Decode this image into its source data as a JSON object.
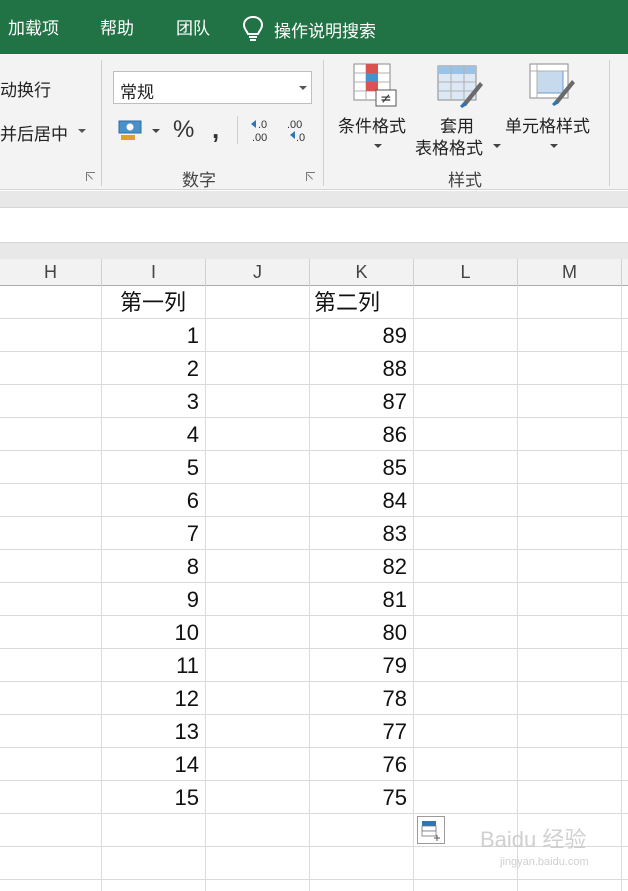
{
  "menu": {
    "items": [
      "加载项",
      "帮助",
      "团队"
    ],
    "search_placeholder": "操作说明搜索"
  },
  "ribbon": {
    "alignment": {
      "wrap_text": "动换行",
      "merge_center": "并后居中"
    },
    "number": {
      "format_value": "常规",
      "percent_symbol": "%",
      "comma_symbol": ",",
      "increase_decimal": "←.0\n.00",
      "decrease_decimal": ".00\n→.0",
      "group_label": "数字"
    },
    "styles": {
      "conditional_formatting": "条件格式",
      "format_as_table_line1": "套用",
      "format_as_table_line2": "表格格式",
      "cell_styles": "单元格样式",
      "group_label": "样式"
    }
  },
  "columns": [
    "H",
    "I",
    "J",
    "K",
    "L",
    "M"
  ],
  "sheet": {
    "header_i": "第一列",
    "header_k": "第二列",
    "col_i": [
      "1",
      "2",
      "3",
      "4",
      "5",
      "6",
      "7",
      "8",
      "9",
      "10",
      "11",
      "12",
      "13",
      "14",
      "15"
    ],
    "col_k": [
      "89",
      "88",
      "87",
      "86",
      "85",
      "84",
      "83",
      "82",
      "81",
      "80",
      "79",
      "78",
      "77",
      "76",
      "75"
    ]
  },
  "watermark": {
    "text": "Baidu 经验",
    "url": "jingyan.baidu.com"
  },
  "colors": {
    "menu_bg": "#217346",
    "ribbon_bg": "#f3f3f3",
    "header_bg": "#f2f2f2",
    "gridline": "#dadada"
  }
}
